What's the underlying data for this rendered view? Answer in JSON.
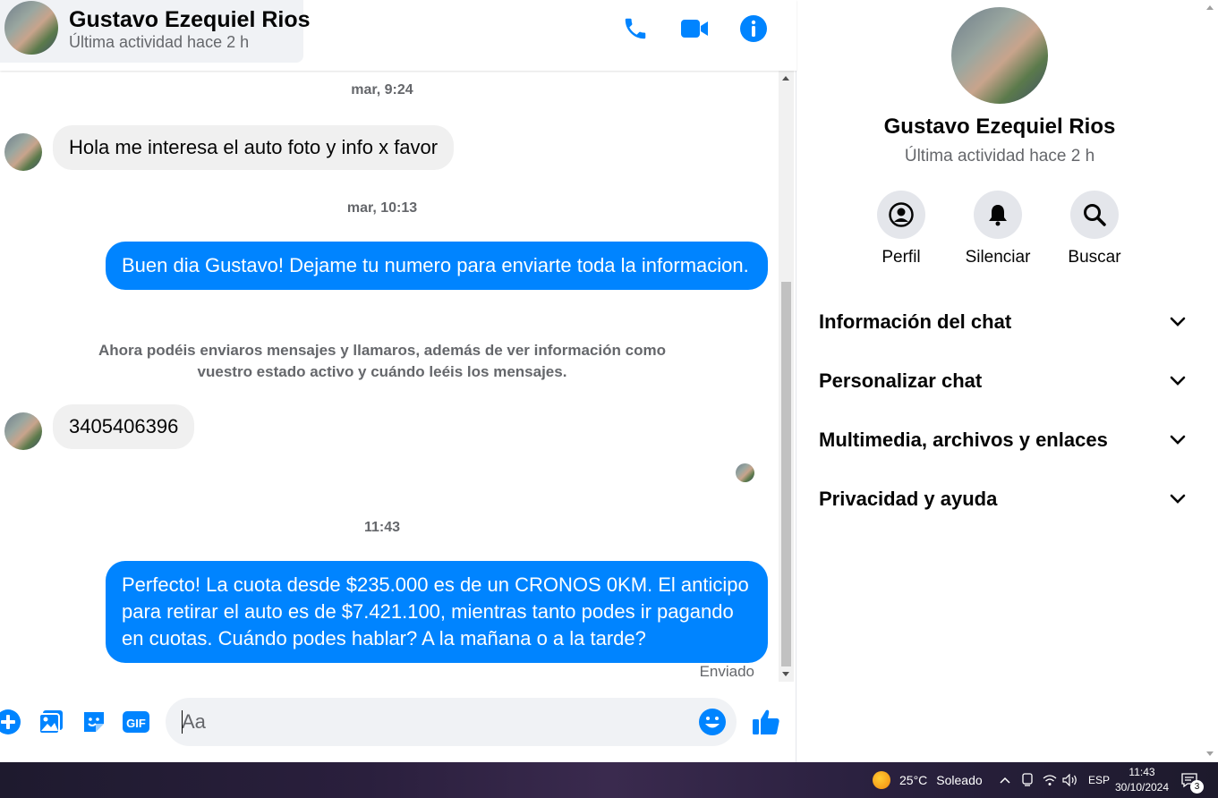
{
  "contact": {
    "name": "Gustavo Ezequiel Rios",
    "status": "Última actividad hace 2 h"
  },
  "header": {
    "actions": [
      "phone-icon",
      "video-call-icon",
      "info-icon"
    ]
  },
  "messages": {
    "ts1": "mar, 9:24",
    "in1": "Hola me interesa el auto foto y info x favor",
    "ts2": "mar, 10:13",
    "out1": "Buen dia Gustavo! Dejame tu numero para enviarte toda la informacion.",
    "system_note": "Ahora podéis enviaros mensajes y llamaros, además de ver información como vuestro estado activo y cuándo leéis los mensajes.",
    "in2": "3405406396",
    "ts3": "11:43",
    "out2": "Perfecto! La cuota desde $235.000 es de un CRONOS 0KM. El anticipo para retirar el auto es de $7.421.100, mientras tanto podes ir pagando en cuotas. Cuándo podes hablar? A la mañana o a la tarde?",
    "sent_status": "Enviado"
  },
  "composer": {
    "placeholder": "Aa",
    "icons": [
      "plus-icon",
      "photo-icon",
      "sticker-icon",
      "gif-icon",
      "emoji-icon",
      "like-icon"
    ],
    "gif_label": "GIF"
  },
  "info_panel": {
    "name": "Gustavo Ezequiel Rios",
    "status": "Última actividad hace 2 h",
    "actions": {
      "profile": "Perfil",
      "mute": "Silenciar",
      "search": "Buscar"
    },
    "sections": {
      "chat_info": "Información del chat",
      "customize": "Personalizar chat",
      "media": "Multimedia, archivos y enlaces",
      "privacy": "Privacidad y ayuda"
    }
  },
  "taskbar": {
    "weather_temp": "25°C",
    "weather_text": "Soleado",
    "language": "ESP",
    "time": "11:43",
    "date": "30/10/2024",
    "notifications": "3"
  },
  "colors": {
    "accent": "#0084ff",
    "incoming_bubble": "#f0f0f0",
    "muted_text": "#65676b"
  }
}
